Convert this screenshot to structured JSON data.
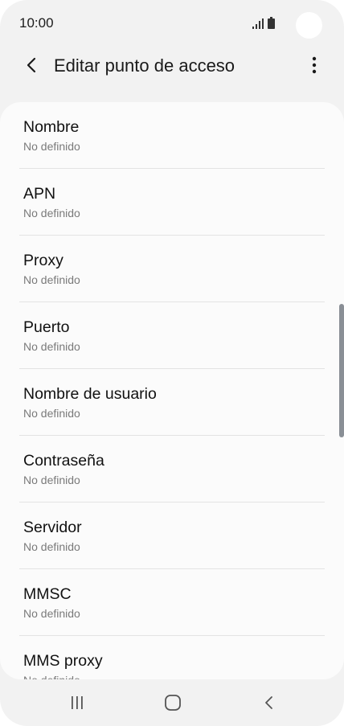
{
  "status_bar": {
    "time": "10:00",
    "icons": [
      "signal-icon",
      "battery-icon"
    ]
  },
  "app_bar": {
    "title": "Editar punto de acceso",
    "back_icon": "chevron-left-icon",
    "more_icon": "more-vertical-icon"
  },
  "settings": [
    {
      "title": "Nombre",
      "value": "No definido"
    },
    {
      "title": "APN",
      "value": "No definido"
    },
    {
      "title": "Proxy",
      "value": "No definido"
    },
    {
      "title": "Puerto",
      "value": "No definido"
    },
    {
      "title": "Nombre de usuario",
      "value": "No definido"
    },
    {
      "title": "Contraseña",
      "value": "No definido"
    },
    {
      "title": "Servidor",
      "value": "No definido"
    },
    {
      "title": "MMSC",
      "value": "No definido"
    },
    {
      "title": "MMS proxy",
      "value": "No definido"
    }
  ],
  "nav_bar": {
    "buttons": [
      "recents-icon",
      "home-icon",
      "back-icon"
    ]
  },
  "colors": {
    "background": "#f2f2f2",
    "card": "#fbfbfb",
    "scrollbar": "#8a8f96"
  }
}
